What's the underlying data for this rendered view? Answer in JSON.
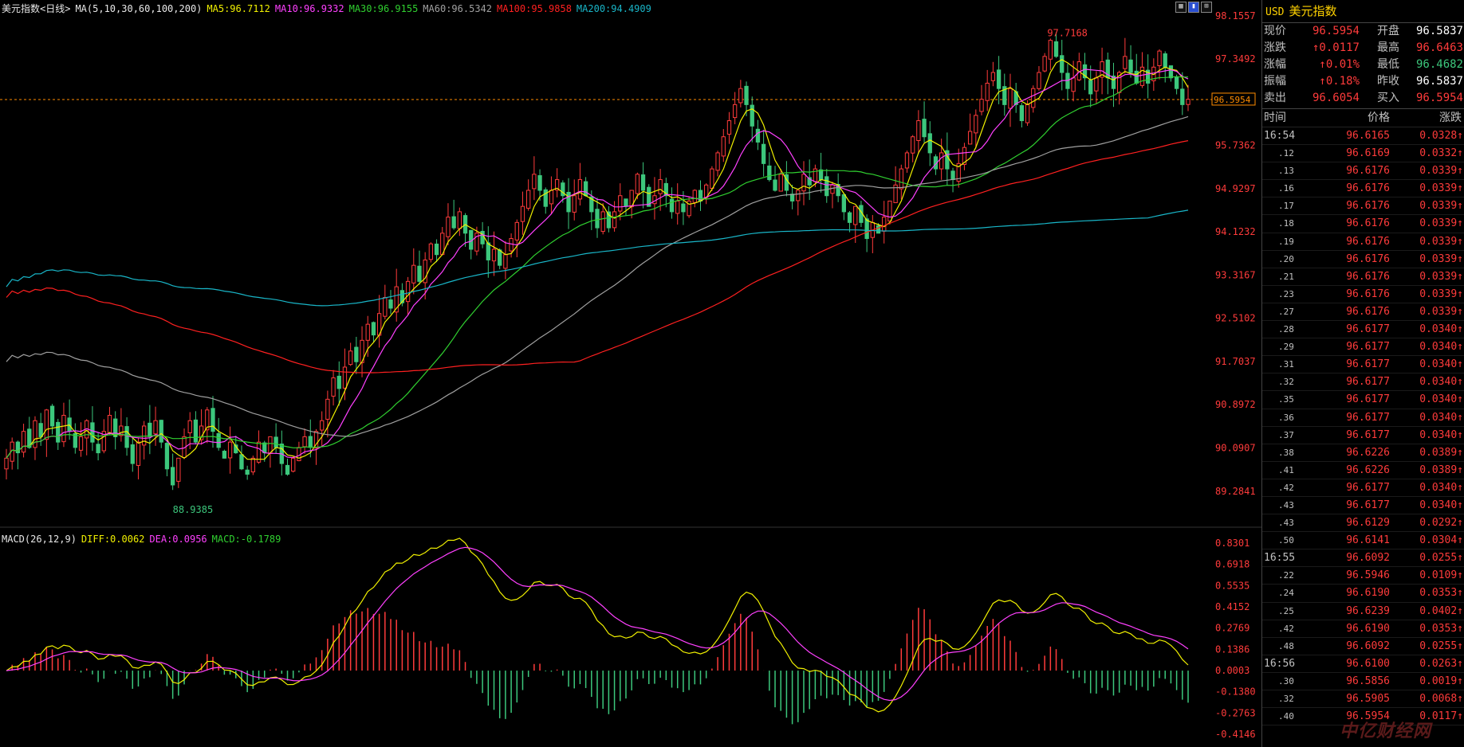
{
  "header": {
    "title": "美元指数<日线>",
    "ma_spec": "MA(5,10,30,60,100,200)",
    "ma5": "MA5:96.7112",
    "ma10": "MA10:96.9332",
    "ma30": "MA30:96.9155",
    "ma60": "MA60:96.5342",
    "ma100": "MA100:95.9858",
    "ma200": "MA200:94.4909"
  },
  "macd_header": {
    "spec": "MACD(26,12,9)",
    "diff": "DIFF:0.0062",
    "dea": "DEA:0.0956",
    "macd": "MACD:-0.1789"
  },
  "price_axis": [
    "98.1557",
    "97.3492",
    "96.5954",
    "95.7362",
    "94.9297",
    "94.1232",
    "93.3167",
    "92.5102",
    "91.7037",
    "90.8972",
    "90.0907",
    "89.2841"
  ],
  "macd_axis": [
    "0.8301",
    "0.6918",
    "0.5535",
    "0.4152",
    "0.2769",
    "0.1386",
    "0.0003",
    "-0.1380",
    "-0.2763",
    "-0.4146"
  ],
  "annotations": {
    "high": "97.7168",
    "low": "88.9385",
    "current": "96.5954"
  },
  "colors": {
    "up": "#ff3b3b",
    "down": "#3cc77c",
    "ma5": "#f0f000",
    "ma10": "#ff40ff",
    "ma30": "#30d030",
    "ma60": "#a0a0a0",
    "ma100": "#ff2020",
    "ma200": "#19b6c8"
  },
  "panel": {
    "code": "USD",
    "name": "美元指数",
    "quotes": [
      {
        "l1": "现价",
        "v1": "96.5954",
        "l2": "开盘",
        "v2": "96.5837"
      },
      {
        "l1": "涨跌",
        "v1": "↑0.0117",
        "l2": "最高",
        "v2": "96.6463"
      },
      {
        "l1": "涨幅",
        "v1": "↑0.01%",
        "l2": "最低",
        "v2": "96.4682"
      },
      {
        "l1": "振幅",
        "v1": "↑0.18%",
        "l2": "昨收",
        "v2": "96.5837"
      },
      {
        "l1": "卖出",
        "v1": "96.6054",
        "l2": "买入",
        "v2": "96.5954"
      }
    ],
    "ticks_header": {
      "time": "时间",
      "price": "价格",
      "change": "涨跌"
    },
    "ticks": [
      {
        "t": "16:54",
        "p": "96.6165",
        "c": "0.0328↑"
      },
      {
        "t": ".12",
        "p": "96.6169",
        "c": "0.0332↑"
      },
      {
        "t": ".13",
        "p": "96.6176",
        "c": "0.0339↑"
      },
      {
        "t": ".16",
        "p": "96.6176",
        "c": "0.0339↑"
      },
      {
        "t": ".17",
        "p": "96.6176",
        "c": "0.0339↑"
      },
      {
        "t": ".18",
        "p": "96.6176",
        "c": "0.0339↑"
      },
      {
        "t": ".19",
        "p": "96.6176",
        "c": "0.0339↑"
      },
      {
        "t": ".20",
        "p": "96.6176",
        "c": "0.0339↑"
      },
      {
        "t": ".21",
        "p": "96.6176",
        "c": "0.0339↑"
      },
      {
        "t": ".23",
        "p": "96.6176",
        "c": "0.0339↑"
      },
      {
        "t": ".27",
        "p": "96.6176",
        "c": "0.0339↑"
      },
      {
        "t": ".28",
        "p": "96.6177",
        "c": "0.0340↑"
      },
      {
        "t": ".29",
        "p": "96.6177",
        "c": "0.0340↑"
      },
      {
        "t": ".31",
        "p": "96.6177",
        "c": "0.0340↑"
      },
      {
        "t": ".32",
        "p": "96.6177",
        "c": "0.0340↑"
      },
      {
        "t": ".35",
        "p": "96.6177",
        "c": "0.0340↑"
      },
      {
        "t": ".36",
        "p": "96.6177",
        "c": "0.0340↑"
      },
      {
        "t": ".37",
        "p": "96.6177",
        "c": "0.0340↑"
      },
      {
        "t": ".38",
        "p": "96.6226",
        "c": "0.0389↑"
      },
      {
        "t": ".41",
        "p": "96.6226",
        "c": "0.0389↑"
      },
      {
        "t": ".42",
        "p": "96.6177",
        "c": "0.0340↑"
      },
      {
        "t": ".43",
        "p": "96.6177",
        "c": "0.0340↑"
      },
      {
        "t": ".43",
        "p": "96.6129",
        "c": "0.0292↑"
      },
      {
        "t": ".50",
        "p": "96.6141",
        "c": "0.0304↑"
      },
      {
        "t": "16:55",
        "p": "96.6092",
        "c": "0.0255↑"
      },
      {
        "t": ".22",
        "p": "96.5946",
        "c": "0.0109↑"
      },
      {
        "t": ".24",
        "p": "96.6190",
        "c": "0.0353↑"
      },
      {
        "t": ".25",
        "p": "96.6239",
        "c": "0.0402↑"
      },
      {
        "t": ".42",
        "p": "96.6190",
        "c": "0.0353↑"
      },
      {
        "t": ".48",
        "p": "96.6092",
        "c": "0.0255↑"
      },
      {
        "t": "16:56",
        "p": "96.6100",
        "c": "0.0263↑"
      },
      {
        "t": ".30",
        "p": "96.5856",
        "c": "0.0019↑"
      },
      {
        "t": ".32",
        "p": "96.5905",
        "c": "0.0068↑"
      },
      {
        "t": ".40",
        "p": "96.5954",
        "c": "0.0117↑"
      }
    ]
  },
  "chart_data": [
    {
      "type": "candlestick",
      "title": "美元指数<日线>",
      "ylim": [
        88.9385,
        98.1557
      ],
      "y_ticks": [
        98.1557,
        97.3492,
        96.5954,
        95.7362,
        94.9297,
        94.1232,
        93.3167,
        92.5102,
        91.7037,
        90.8972,
        90.0907,
        89.2841
      ],
      "close": [
        89.9,
        90.2,
        90.0,
        90.4,
        90.1,
        90.6,
        90.3,
        90.8,
        90.5,
        90.2,
        90.7,
        90.4,
        90.1,
        90.3,
        90.6,
        90.2,
        90.0,
        90.4,
        90.7,
        90.3,
        90.5,
        90.1,
        89.8,
        90.2,
        90.5,
        90.3,
        90.6,
        90.2,
        89.7,
        89.4,
        89.9,
        90.3,
        90.6,
        90.2,
        90.5,
        90.8,
        90.4,
        90.1,
        89.9,
        90.2,
        90.0,
        89.7,
        89.6,
        89.9,
        90.2,
        90.0,
        90.3,
        90.1,
        89.8,
        89.6,
        89.9,
        90.1,
        90.3,
        90.1,
        90.4,
        90.6,
        91.0,
        91.4,
        91.2,
        91.6,
        91.9,
        91.7,
        92.1,
        92.4,
        92.2,
        92.6,
        92.9,
        92.7,
        93.1,
        92.8,
        93.2,
        93.5,
        93.2,
        93.6,
        93.9,
        93.7,
        94.1,
        94.4,
        94.2,
        94.5,
        94.1,
        93.8,
        94.1,
        93.9,
        93.6,
        93.8,
        93.5,
        93.7,
        94.0,
        94.3,
        94.6,
        94.9,
        95.2,
        94.9,
        94.6,
        94.9,
        95.1,
        94.8,
        94.5,
        94.8,
        95.1,
        94.8,
        94.5,
        94.2,
        94.5,
        94.2,
        94.5,
        94.8,
        94.6,
        94.9,
        95.2,
        94.9,
        94.6,
        94.8,
        95.1,
        94.8,
        94.5,
        94.7,
        94.5,
        94.7,
        94.9,
        94.7,
        95.0,
        95.3,
        95.6,
        95.9,
        96.2,
        96.5,
        96.8,
        96.5,
        96.1,
        95.8,
        95.4,
        95.1,
        94.9,
        95.2,
        94.9,
        94.7,
        94.9,
        95.2,
        95.0,
        95.3,
        95.1,
        94.8,
        95.0,
        94.8,
        94.5,
        94.3,
        94.6,
        94.3,
        94.0,
        94.3,
        94.1,
        94.4,
        94.7,
        95.0,
        95.3,
        95.6,
        95.9,
        96.2,
        95.9,
        95.6,
        95.3,
        95.6,
        95.3,
        95.1,
        95.4,
        95.7,
        96.0,
        96.3,
        96.6,
        96.9,
        97.1,
        96.8,
        96.5,
        96.8,
        96.5,
        96.2,
        96.5,
        96.8,
        97.1,
        97.4,
        97.7,
        97.4,
        97.1,
        96.8,
        97.0,
        97.3,
        97.0,
        96.7,
        97.0,
        97.3,
        97.0,
        96.8,
        97.1,
        97.4,
        97.1,
        96.9,
        97.2,
        96.9,
        97.2,
        97.5,
        97.2,
        97.0,
        96.8,
        96.5,
        96.6
      ]
    },
    {
      "type": "macd",
      "ylim": [
        -0.4146,
        0.8301
      ],
      "series": [
        {
          "name": "DIFF",
          "last": 0.0062
        },
        {
          "name": "DEA",
          "last": 0.0956
        },
        {
          "name": "MACD",
          "last": -0.1789
        }
      ]
    }
  ]
}
